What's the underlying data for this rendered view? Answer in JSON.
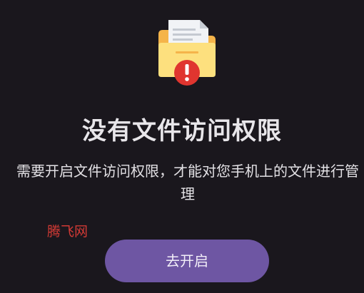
{
  "illustration": {
    "icon": "folder-with-document-and-warning-icon",
    "colors": {
      "folder_back": "#f5b44a",
      "folder_front": "#fde07e",
      "paper": "#f1f3f6",
      "warning": "#e0352f"
    }
  },
  "title": "没有文件访问权限",
  "description": "需要开启文件访问权限，才能对您手机上的文件进行管理",
  "watermark": "腾飞网",
  "enable_button": {
    "label": "去开启",
    "color": "#6e56a3"
  },
  "background": "#1a171d"
}
